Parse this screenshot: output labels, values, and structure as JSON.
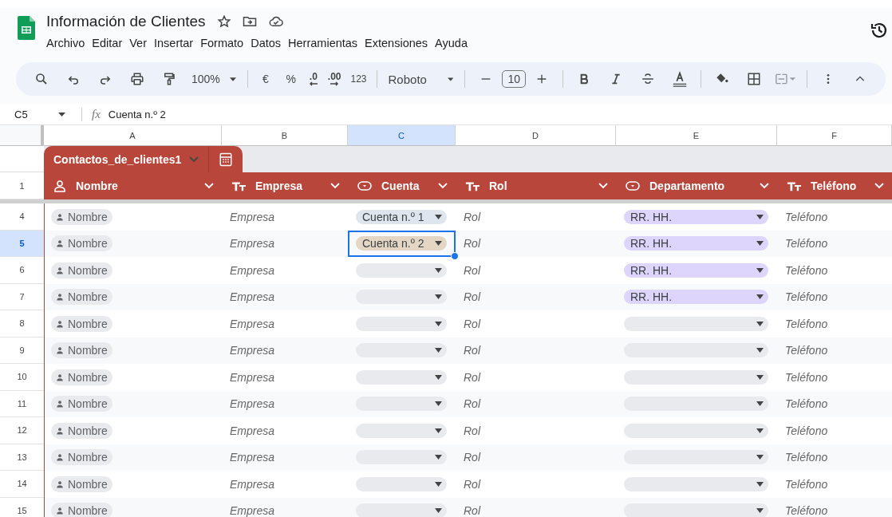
{
  "document": {
    "title": "Información de Clientes"
  },
  "menu": [
    "Archivo",
    "Editar",
    "Ver",
    "Insertar",
    "Formato",
    "Datos",
    "Herramientas",
    "Extensiones",
    "Ayuda"
  ],
  "toolbar": {
    "zoom": "100%",
    "currency": "€",
    "percent": "%",
    "decrease_decimals": ".0",
    "increase_decimals": ".00",
    "number_format": "123",
    "font": "Roboto",
    "font_size": "10"
  },
  "formula_bar": {
    "cell": "C5",
    "fx": "fx",
    "value": "Cuenta n.º 2"
  },
  "columns": [
    {
      "letter": "A",
      "selected": false
    },
    {
      "letter": "B",
      "selected": false
    },
    {
      "letter": "C",
      "selected": true
    },
    {
      "letter": "D",
      "selected": false
    },
    {
      "letter": "E",
      "selected": false
    },
    {
      "letter": "F",
      "selected": false
    }
  ],
  "table": {
    "name": "Contactos_de_clientes1",
    "header_row": "1",
    "fields": [
      {
        "name": "Nombre",
        "kind": "person"
      },
      {
        "name": "Empresa",
        "kind": "text"
      },
      {
        "name": "Cuenta",
        "kind": "dropdown"
      },
      {
        "name": "Rol",
        "kind": "text"
      },
      {
        "name": "Departamento",
        "kind": "dropdown"
      },
      {
        "name": "Teléfono",
        "kind": "text"
      }
    ],
    "rows": [
      {
        "number": "4",
        "selected": false,
        "nombre": "Nombre",
        "empresa": "Empresa",
        "cuenta": {
          "value": "Cuenta n.º 1",
          "color": "#dfe5ef"
        },
        "rol": "Rol",
        "departamento": {
          "value": "RR. HH.",
          "color": "#ddd5fb"
        },
        "telefono": "Teléfono"
      },
      {
        "number": "5",
        "selected": true,
        "nombre": "Nombre",
        "empresa": "Empresa",
        "cuenta": {
          "value": "Cuenta n.º 2",
          "color": "#e3d6c5"
        },
        "rol": "Rol",
        "departamento": {
          "value": "RR. HH.",
          "color": "#ddd5fb"
        },
        "telefono": "Teléfono"
      },
      {
        "number": "6",
        "selected": false,
        "nombre": "Nombre",
        "empresa": "Empresa",
        "cuenta": {
          "color": "#e8eaed"
        },
        "rol": "Rol",
        "departamento": {
          "value": "RR. HH.",
          "color": "#ddd5fb"
        },
        "telefono": "Teléfono"
      },
      {
        "number": "7",
        "selected": false,
        "nombre": "Nombre",
        "empresa": "Empresa",
        "cuenta": {
          "color": "#e8eaed"
        },
        "rol": "Rol",
        "departamento": {
          "value": "RR. HH.",
          "color": "#ddd5fb"
        },
        "telefono": "Teléfono"
      },
      {
        "number": "8",
        "selected": false,
        "nombre": "Nombre",
        "empresa": "Empresa",
        "cuenta": {
          "color": "#e8eaed"
        },
        "rol": "Rol",
        "departamento": {
          "color": "#e8eaed"
        },
        "telefono": "Teléfono"
      },
      {
        "number": "9",
        "selected": false,
        "nombre": "Nombre",
        "empresa": "Empresa",
        "cuenta": {
          "color": "#e8eaed"
        },
        "rol": "Rol",
        "departamento": {
          "color": "#e8eaed"
        },
        "telefono": "Teléfono"
      },
      {
        "number": "10",
        "selected": false,
        "nombre": "Nombre",
        "empresa": "Empresa",
        "cuenta": {
          "color": "#e8eaed"
        },
        "rol": "Rol",
        "departamento": {
          "color": "#e8eaed"
        },
        "telefono": "Teléfono"
      },
      {
        "number": "11",
        "selected": false,
        "nombre": "Nombre",
        "empresa": "Empresa",
        "cuenta": {
          "color": "#e8eaed"
        },
        "rol": "Rol",
        "departamento": {
          "color": "#e8eaed"
        },
        "telefono": "Teléfono"
      },
      {
        "number": "12",
        "selected": false,
        "nombre": "Nombre",
        "empresa": "Empresa",
        "cuenta": {
          "color": "#e8eaed"
        },
        "rol": "Rol",
        "departamento": {
          "color": "#e8eaed"
        },
        "telefono": "Teléfono"
      },
      {
        "number": "13",
        "selected": false,
        "nombre": "Nombre",
        "empresa": "Empresa",
        "cuenta": {
          "color": "#e8eaed"
        },
        "rol": "Rol",
        "departamento": {
          "color": "#e8eaed"
        },
        "telefono": "Teléfono"
      },
      {
        "number": "14",
        "selected": false,
        "nombre": "Nombre",
        "empresa": "Empresa",
        "cuenta": {
          "color": "#e8eaed"
        },
        "rol": "Rol",
        "departamento": {
          "color": "#e8eaed"
        },
        "telefono": "Teléfono"
      },
      {
        "number": "15",
        "selected": false,
        "nombre": "Nombre",
        "empresa": "Empresa",
        "cuenta": {
          "color": "#e8eaed"
        },
        "rol": "Rol",
        "departamento": {
          "color": "#e8eaed"
        },
        "telefono": "Teléfono"
      }
    ]
  }
}
